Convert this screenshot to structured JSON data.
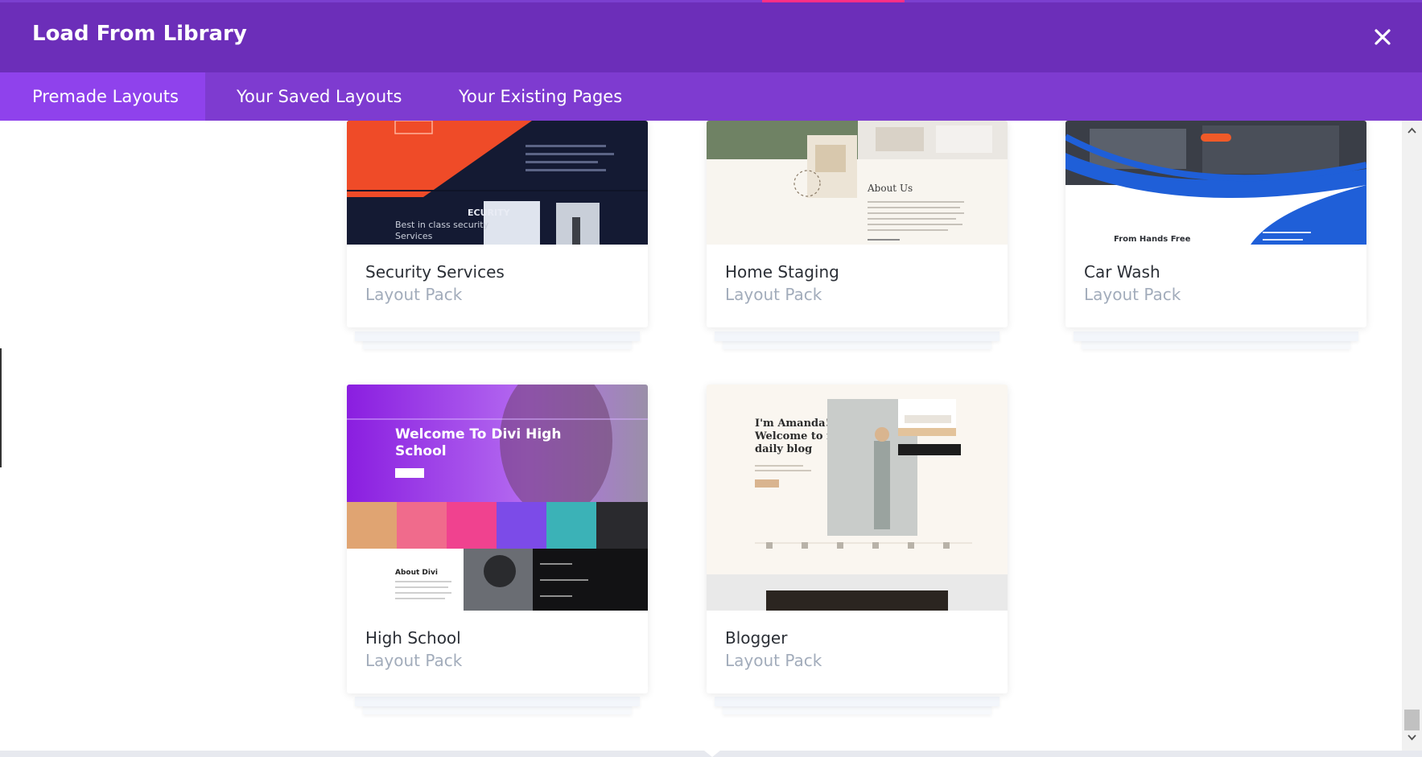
{
  "modal": {
    "title": "Load From Library",
    "close_icon": "close-icon"
  },
  "tabs": [
    {
      "label": "Premade Layouts",
      "active": true
    },
    {
      "label": "Your Saved Layouts",
      "active": false
    },
    {
      "label": "Your Existing Pages",
      "active": false
    }
  ],
  "cards": [
    {
      "name": "Security Services",
      "kind": "Layout Pack",
      "thumb_text": [
        "ECURITY",
        "Best in class security",
        "Services"
      ]
    },
    {
      "name": "Home Staging",
      "kind": "Layout Pack",
      "thumb_text": [
        "About Us"
      ]
    },
    {
      "name": "Car Wash",
      "kind": "Layout Pack",
      "thumb_text": [
        "From Hands Free"
      ]
    },
    {
      "name": "High School",
      "kind": "Layout Pack",
      "thumb_text": [
        "Welcome To Divi High",
        "School",
        "About Divi"
      ]
    },
    {
      "name": "Blogger",
      "kind": "Layout Pack",
      "thumb_text": [
        "I'm Amanda!",
        "Welcome to my",
        "daily blog"
      ]
    }
  ],
  "colors": {
    "titlebar": "#6c2eb9",
    "tabbar": "#7e3bd0",
    "active_tab": "#8f42ec",
    "card_title": "#2b2f36",
    "card_subtitle": "#a2acbb"
  }
}
